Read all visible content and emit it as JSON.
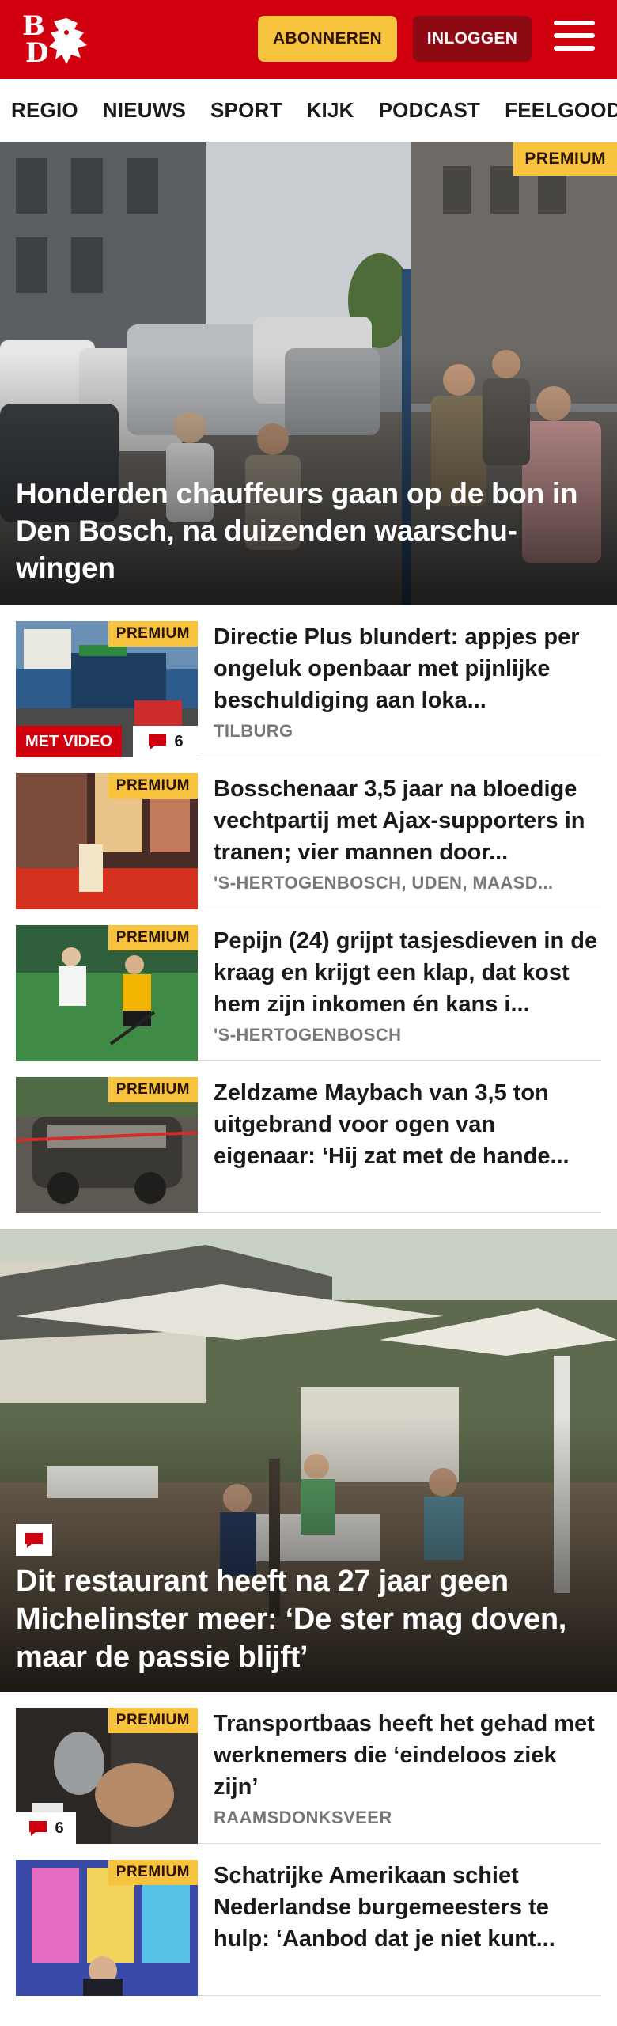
{
  "header": {
    "logo_letters": [
      "B",
      "D"
    ],
    "subscribe_label": "ABONNEREN",
    "login_label": "INLOGGEN",
    "colors": {
      "brand": "#d1000f",
      "premium": "#f7c33c",
      "login": "#8e0a12"
    }
  },
  "nav": {
    "items": [
      "REGIO",
      "NIEUWS",
      "SPORT",
      "KIJK",
      "PODCAST",
      "FEELGOOD"
    ]
  },
  "hero": {
    "badge": "PREMIUM",
    "title": "Honderden chauffeurs gaan op de bon in Den Bosch, na duizenden waarschu­wingen"
  },
  "articles": [
    {
      "badge": "PREMIUM",
      "title": "Directie Plus blundert: appjes per ongeluk openbaar met pijnlijke beschuldiging aan loka...",
      "location": "TILBURG",
      "video_label": "MET VIDEO",
      "comments": "6",
      "comment_icon": "comment-icon"
    },
    {
      "badge": "PREMIUM",
      "title": "Bosschenaar 3,5 jaar na bloedige vechtpartij met Ajax-supporters in tranen; vier mannen door...",
      "location": "'S-HERTOGENBOSCH, UDEN, MAASD..."
    },
    {
      "badge": "PREMIUM",
      "title": "Pepijn (24) grijpt tasjesdieven in de kraag en krijgt een klap, dat kost hem zijn inkomen én kans i...",
      "location": "'S-HERTOGENBOSCH"
    },
    {
      "badge": "PREMIUM",
      "title": "Zeldzame Maybach van 3,5 ton uitgebrand voor ogen van eigenaar: ‘Hij zat met de hande...",
      "location": ""
    }
  ],
  "feature": {
    "title": "Dit restaurant heeft na 27 jaar geen Michelinster meer: ‘De ster mag doven, maar de passie blijft’",
    "comment_icon": "comment-icon"
  },
  "articles2": [
    {
      "badge": "PREMIUM",
      "title": "Transportbaas heeft het gehad met werknemers die ‘eindeloos ziek zijn’",
      "location": "RAAMSDONKSVEER",
      "comments": "6"
    },
    {
      "badge": "PREMIUM",
      "title": "Schatrijke Amerikaan schiet Nederlandse burgemeesters te hulp: ‘Aanbod dat je niet kunt...",
      "location": ""
    }
  ]
}
